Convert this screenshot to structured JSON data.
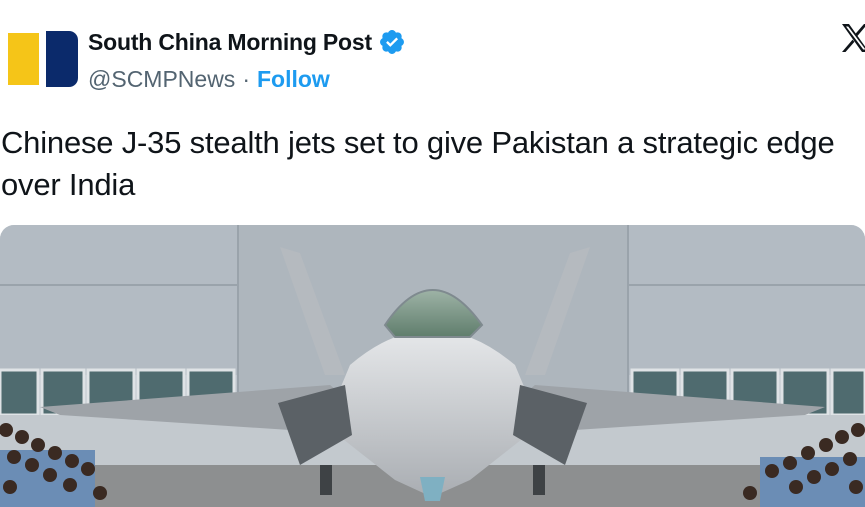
{
  "account": {
    "display_name": "South China Morning Post",
    "handle": "@SCMPNews",
    "separator": "·",
    "follow_label": "Follow",
    "verified": true
  },
  "post": {
    "text": "Chinese J-35 stealth jets set to give Pakistan a strategic edge over India"
  },
  "media": {
    "type": "photo",
    "subject": "J-35 stealth fighter jet in front of a hangar with rows of people"
  },
  "colors": {
    "accent": "#1d9bf0",
    "text": "#0f1419",
    "secondary_text": "#536471",
    "logo_yellow": "#f5c518",
    "logo_navy": "#0b2a6b"
  },
  "icons": {
    "verified": "verified-badge-icon",
    "platform": "x-logo-icon"
  }
}
